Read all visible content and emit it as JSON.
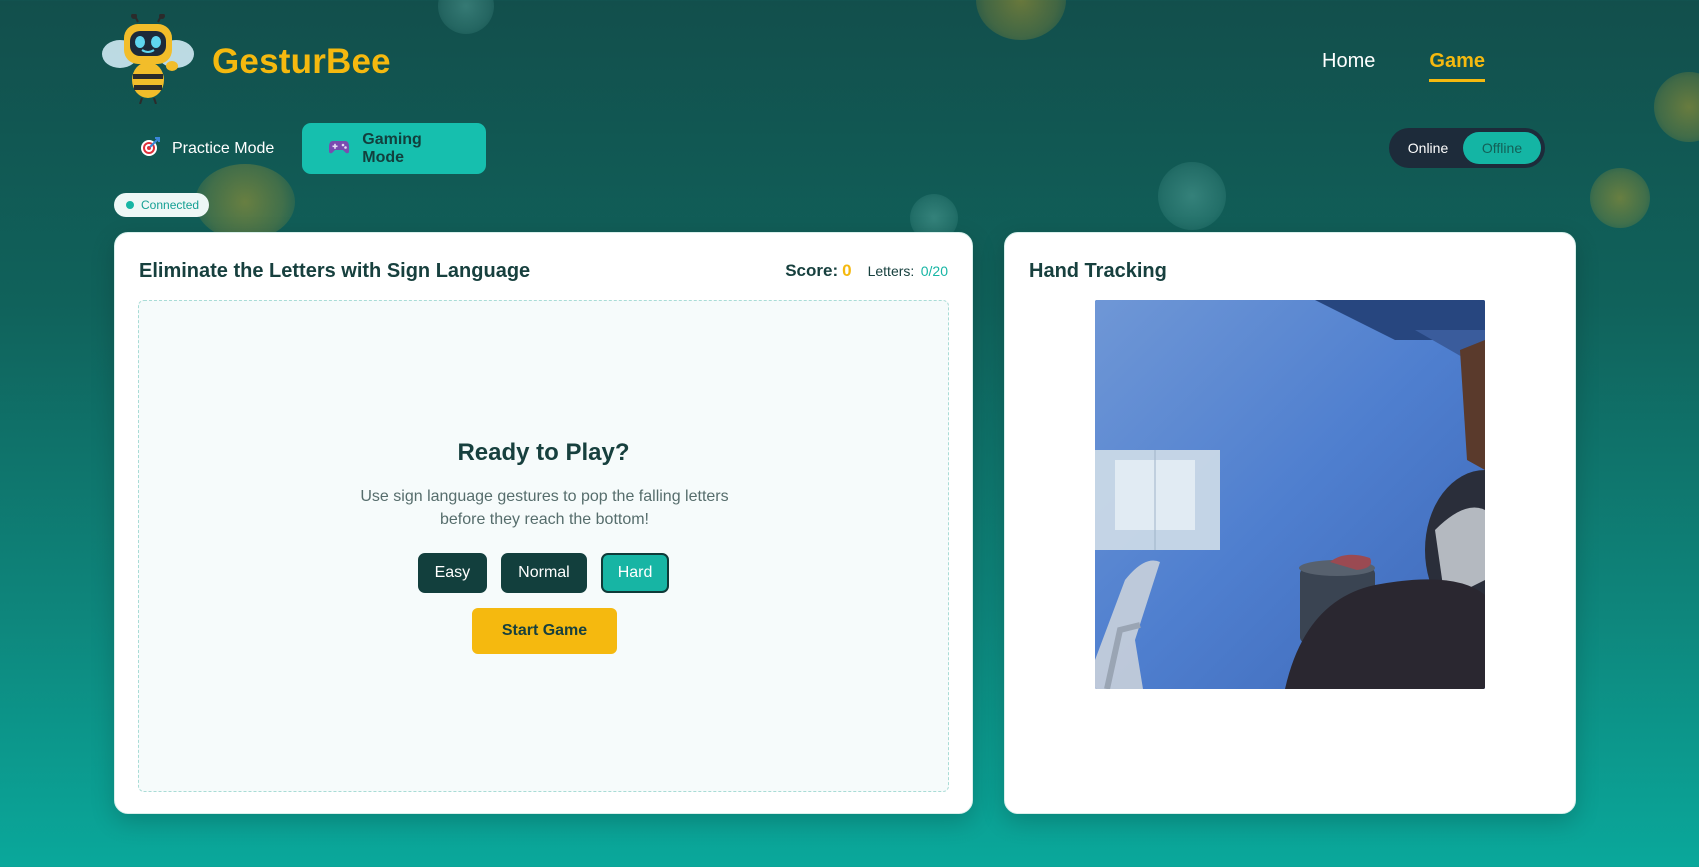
{
  "brand": {
    "name": "GesturBee",
    "logo_icon": "bee-robot-logo"
  },
  "nav": {
    "home": "Home",
    "game": "Game",
    "active": "Game"
  },
  "modes": {
    "practice": {
      "label": "Practice Mode",
      "icon": "target-icon"
    },
    "gaming": {
      "label": "Gaming Mode",
      "icon": "gamepad-icon"
    },
    "active": "gaming"
  },
  "connection_toggle": {
    "online": "Online",
    "offline": "Offline",
    "selected": "Offline"
  },
  "status_badge": {
    "label": "Connected"
  },
  "game_card": {
    "title": "Eliminate the Letters with Sign Language",
    "score_label": "Score:",
    "score_value": "0",
    "letters_label": "Letters:",
    "letters_value": "0/20",
    "ready_title": "Ready to Play?",
    "description": "Use sign language gestures to pop the falling letters before they reach the bottom!",
    "difficulties": [
      "Easy",
      "Normal",
      "Hard"
    ],
    "selected_difficulty": "Hard",
    "start_label": "Start Game"
  },
  "tracking_card": {
    "title": "Hand Tracking"
  },
  "colors": {
    "accent_yellow": "#f5b90f",
    "accent_teal": "#17b5a4",
    "dark_teal": "#123f3d",
    "bg_top": "#124f4c",
    "bg_bottom": "#0aa89b"
  }
}
